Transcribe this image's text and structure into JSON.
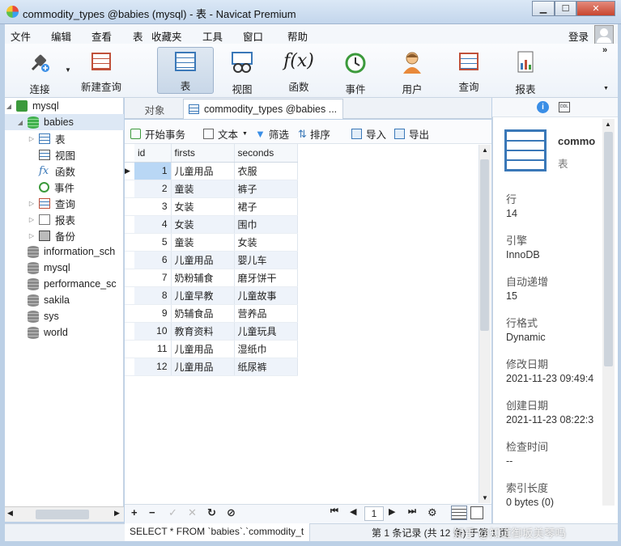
{
  "window": {
    "title": "commodity_types @babies (mysql) - 表 - Navicat Premium",
    "min": "▁",
    "max": "☐",
    "close": "✕"
  },
  "menu": [
    "文件",
    "编辑",
    "查看",
    "表",
    "收藏夹",
    "工具",
    "窗口",
    "帮助"
  ],
  "login": "登录",
  "toolbar": [
    {
      "label": "连接",
      "icon": "plug-icon"
    },
    {
      "label": "新建查询",
      "icon": "new-query-icon"
    },
    {
      "label": "表",
      "icon": "table-icon"
    },
    {
      "label": "视图",
      "icon": "view-icon"
    },
    {
      "label": "函数",
      "icon": "function-icon"
    },
    {
      "label": "事件",
      "icon": "clock-icon"
    },
    {
      "label": "用户",
      "icon": "user-icon"
    },
    {
      "label": "查询",
      "icon": "query-icon"
    },
    {
      "label": "报表",
      "icon": "report-icon"
    }
  ],
  "tree": {
    "connection": "mysql",
    "current_db": "babies",
    "children": [
      "表",
      "视图",
      "函数",
      "事件",
      "查询",
      "报表",
      "备份"
    ],
    "databases": [
      "information_sch",
      "mysql",
      "performance_sc",
      "sakila",
      "sys",
      "world"
    ]
  },
  "tabs": {
    "objects": "对象",
    "active": "commodity_types @babies ..."
  },
  "subtoolbar": {
    "begin_tx": "开始事务",
    "text": "文本",
    "filter": "筛选",
    "sort": "排序",
    "import": "导入",
    "export": "导出"
  },
  "grid": {
    "columns": [
      "id",
      "firsts",
      "seconds"
    ],
    "rows": [
      [
        "1",
        "儿童用品",
        "衣服"
      ],
      [
        "2",
        "童装",
        "裤子"
      ],
      [
        "3",
        "女装",
        "裙子"
      ],
      [
        "4",
        "女装",
        "围巾"
      ],
      [
        "5",
        "童装",
        "女装"
      ],
      [
        "6",
        "儿童用品",
        "婴儿车"
      ],
      [
        "7",
        "奶粉辅食",
        "磨牙饼干"
      ],
      [
        "8",
        "儿童早教",
        "儿童故事"
      ],
      [
        "9",
        "奶辅食品",
        "营养品"
      ],
      [
        "10",
        "教育资料",
        "儿童玩具"
      ],
      [
        "11",
        "儿童用品",
        "湿纸巾"
      ],
      [
        "12",
        "儿童用品",
        "纸尿裤"
      ]
    ]
  },
  "nav": {
    "page": "1"
  },
  "info": {
    "name": "commo",
    "kind": "表",
    "fields": [
      {
        "label": "行",
        "value": "14"
      },
      {
        "label": "引擎",
        "value": "InnoDB"
      },
      {
        "label": "自动递增",
        "value": "15"
      },
      {
        "label": "行格式",
        "value": "Dynamic"
      },
      {
        "label": "修改日期",
        "value": "2021-11-23 09:49:4"
      },
      {
        "label": "创建日期",
        "value": "2021-11-23 08:22:3"
      },
      {
        "label": "检查时间",
        "value": "--"
      },
      {
        "label": "索引长度",
        "value": "0 bytes (0)"
      }
    ]
  },
  "status": {
    "sql": "SELECT * FROM `babies`.`commodity_t",
    "records": "第 1 条记录 (共 12 条) 于第 1 页"
  },
  "watermark": "知乎 @知道御坂美琴吗",
  "colors": {
    "accent": "#3a78b8",
    "selection": "#b9d7f5",
    "even_row": "#eef3fa"
  }
}
